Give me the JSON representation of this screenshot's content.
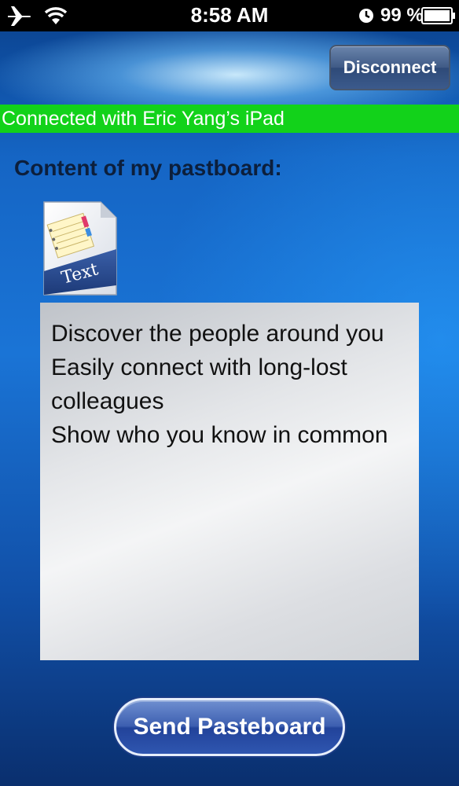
{
  "status_bar": {
    "time": "8:58 AM",
    "battery_percent": "99 %",
    "icons": [
      "airplane-icon",
      "wifi-icon",
      "lock-rotation-icon",
      "battery-icon"
    ]
  },
  "toolbar": {
    "disconnect_label": "Disconnect"
  },
  "connection": {
    "status_text": "Connected with Eric Yang’s iPad",
    "banner_color": "#12d21a"
  },
  "pasteboard": {
    "section_label": "Content of my pastboard:",
    "file_icon_label": "Text",
    "lines": [
      "Discover the people around you",
      "Easily connect with long-lost",
      "colleagues",
      "Show who you know in common"
    ]
  },
  "actions": {
    "send_label": "Send Pasteboard"
  }
}
